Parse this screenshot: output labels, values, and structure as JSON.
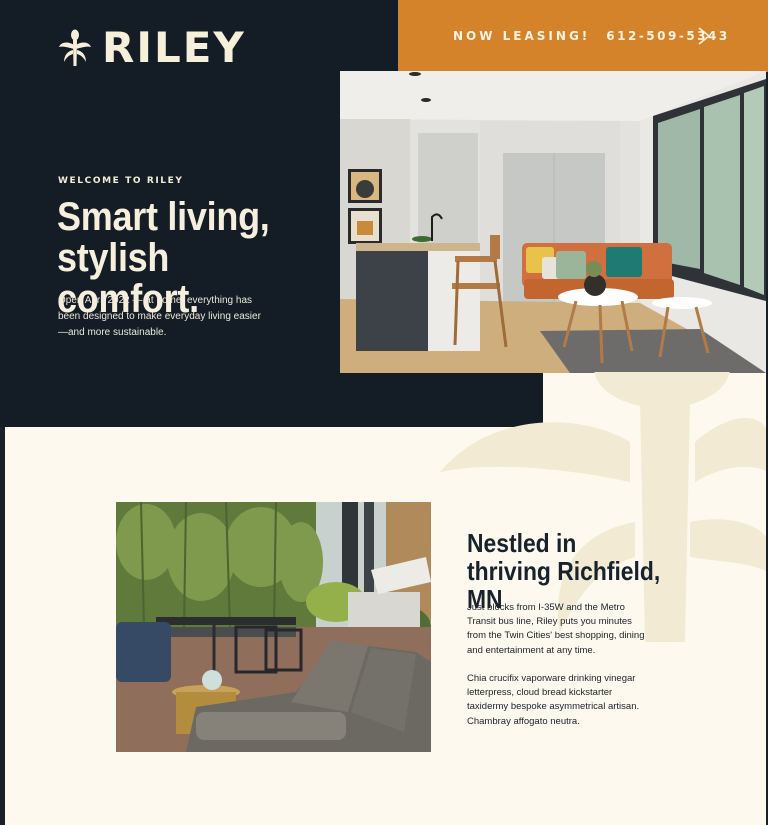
{
  "header": {
    "logo_text": "RILEY",
    "leasing_label": "NOW LEASING!",
    "phone": "612-509-5343"
  },
  "hero": {
    "eyebrow": "WELCOME TO RILEY",
    "headline": "Smart living, stylish comfort.",
    "description": "Open April 2022 — at home, everything has been designed to make everyday living easier—and more sustainable."
  },
  "location": {
    "title": "Nestled in thriving Richfield, MN",
    "paragraph1": "Just blocks from I-35W and the Metro Transit bus line, Riley puts you minutes from the Twin Cities' best shopping, dining and entertainment at any time.",
    "paragraph2": "Chia crucifix vaporware drinking vinegar letterpress, cloud bread kickstarter taxidermy bespoke asymmetrical artisan. Chambray affogato neutra."
  },
  "colors": {
    "dark": "#141d25",
    "accent": "#d4832a",
    "cream": "#fdf9ee"
  },
  "icons": {
    "logo": "riley-flower-icon",
    "leasing_arrow": "chevron-right-icon"
  }
}
